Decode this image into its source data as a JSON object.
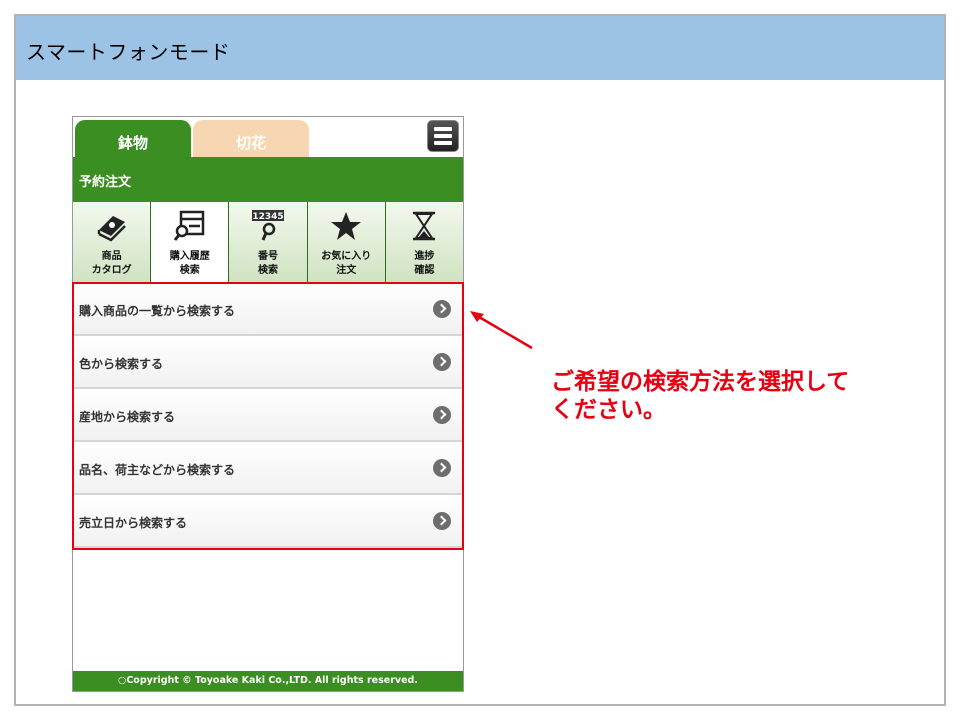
{
  "slide": {
    "title": "スマートフォンモード",
    "callout_line1": "ご希望の検索方法を選択して",
    "callout_line2": "ください。",
    "accent_red": "#e60012",
    "header_color": "#9cc3e6"
  },
  "app": {
    "tabs": [
      {
        "label": "鉢物",
        "active": true
      },
      {
        "label": "切花",
        "active": false
      }
    ],
    "menu_icon": "hamburger-menu-icon",
    "section_title": "予約注文",
    "brand_green": "#3b8e22",
    "icon_nav": [
      {
        "icon": "catalog-icon",
        "line1": "商品",
        "line2": "カタログ",
        "selected": false
      },
      {
        "icon": "purchase-history-search-icon",
        "line1": "購入履歴",
        "line2": "検索",
        "selected": true
      },
      {
        "icon": "number-search-icon",
        "badge": "12345",
        "line1": "番号",
        "line2": "検索",
        "selected": false
      },
      {
        "icon": "star-icon",
        "line1": "お気に入り",
        "line2": "注文",
        "selected": false
      },
      {
        "icon": "hourglass-icon",
        "line1": "進捗",
        "line2": "確認",
        "selected": false
      }
    ],
    "search_options": [
      {
        "label": "購入商品の一覧から検索する"
      },
      {
        "label": "色から検索する"
      },
      {
        "label": "産地から検索する"
      },
      {
        "label": "品名、荷主などから検索する"
      },
      {
        "label": "売立日から検索する"
      }
    ],
    "footer": "○Copyright © Toyoake Kaki Co.,LTD. All rights reserved."
  }
}
